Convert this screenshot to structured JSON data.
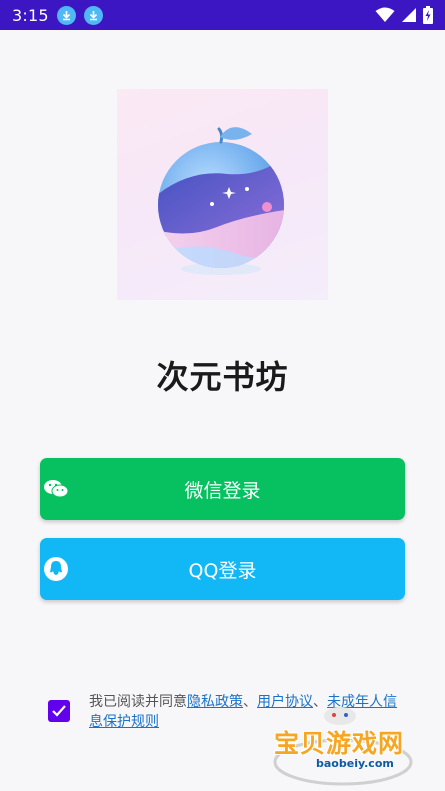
{
  "status_bar": {
    "time": "3:15",
    "icons": [
      "download-icon",
      "download-icon",
      "wifi-icon",
      "signal-icon",
      "battery-charging-icon"
    ]
  },
  "app": {
    "title": "次元书坊",
    "logo": "orange-planet-logo"
  },
  "login": {
    "wechat_label": "微信登录",
    "qq_label": "QQ登录",
    "wechat_color": "#07c160",
    "qq_color": "#12b7f5"
  },
  "agreement": {
    "checked": true,
    "prefix": "我已阅读并同意",
    "privacy": "隐私政策",
    "sep": "、",
    "user_agreement": "用户协议",
    "sep2": "、",
    "minor_policy": "未成年人信息保护规则"
  },
  "watermark": {
    "text": "宝贝游戏网",
    "url": "baobeiy.com"
  }
}
